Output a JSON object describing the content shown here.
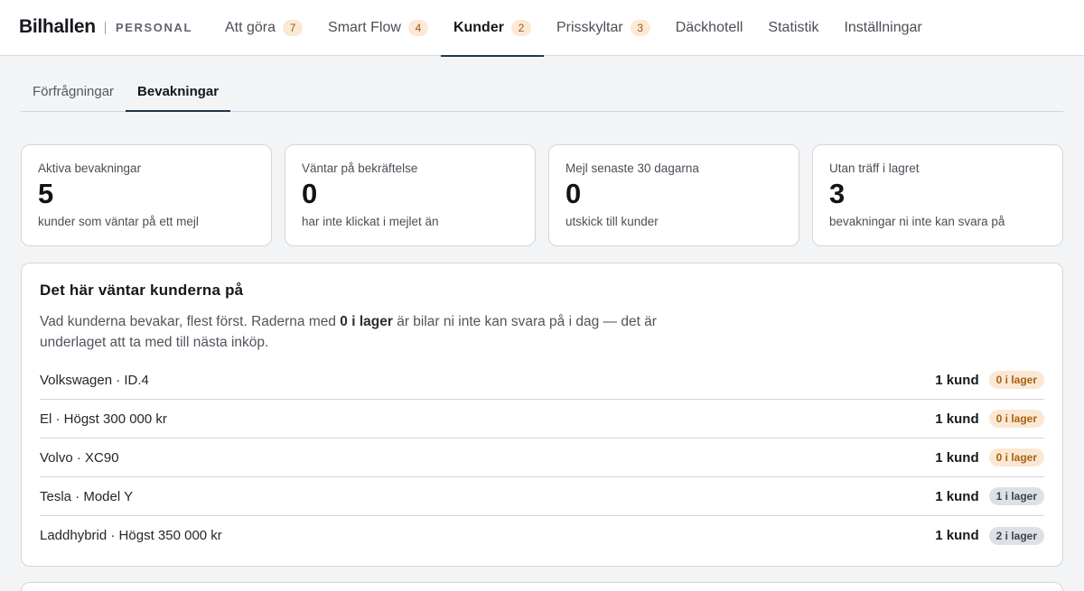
{
  "brand": {
    "name": "Bilhallen",
    "tagline": "PERSONAL"
  },
  "nav": [
    {
      "label": "Att göra",
      "badge": "7",
      "active": false
    },
    {
      "label": "Smart Flow",
      "badge": "4",
      "active": false
    },
    {
      "label": "Kunder",
      "badge": "2",
      "active": true
    },
    {
      "label": "Prisskyltar",
      "badge": "3",
      "active": false
    },
    {
      "label": "Däckhotell",
      "badge": null,
      "active": false
    },
    {
      "label": "Statistik",
      "badge": null,
      "active": false
    },
    {
      "label": "Inställningar",
      "badge": null,
      "active": false
    }
  ],
  "subtabs": [
    {
      "label": "Förfrågningar",
      "active": false
    },
    {
      "label": "Bevakningar",
      "active": true
    }
  ],
  "stats": [
    {
      "label": "Aktiva bevakningar",
      "value": "5",
      "sub": "kunder som väntar på ett mejl"
    },
    {
      "label": "Väntar på bekräftelse",
      "value": "0",
      "sub": "har inte klickat i mejlet än"
    },
    {
      "label": "Mejl senaste 30 dagarna",
      "value": "0",
      "sub": "utskick till kunder"
    },
    {
      "label": "Utan träff i lagret",
      "value": "3",
      "sub": "bevakningar ni inte kan svara på"
    }
  ],
  "demand": {
    "title": "Det här väntar kunderna på",
    "desc_before": "Vad kunderna bevakar, flest först. Raderna med ",
    "desc_bold": "0 i lager",
    "desc_after": " är bilar ni inte kan svara på i dag — det är underlaget att ta med till nästa inköp.",
    "rows": [
      {
        "name": "Volkswagen · ID.4",
        "count": "1 kund",
        "stock": "0 i lager",
        "in_stock": false
      },
      {
        "name": "El · Högst 300 000 kr",
        "count": "1 kund",
        "stock": "0 i lager",
        "in_stock": false
      },
      {
        "name": "Volvo · XC90",
        "count": "1 kund",
        "stock": "0 i lager",
        "in_stock": false
      },
      {
        "name": "Tesla · Model Y",
        "count": "1 kund",
        "stock": "1 i lager",
        "in_stock": true
      },
      {
        "name": "Laddhybrid · Högst 350 000 kr",
        "count": "1 kund",
        "stock": "2 i lager",
        "in_stock": true
      }
    ]
  },
  "colors": {
    "accent": "#23344a",
    "badge_warn_bg": "#fbe8d4",
    "badge_warn_fg": "#a8620e",
    "badge_neutral_bg": "#dde1e5"
  }
}
